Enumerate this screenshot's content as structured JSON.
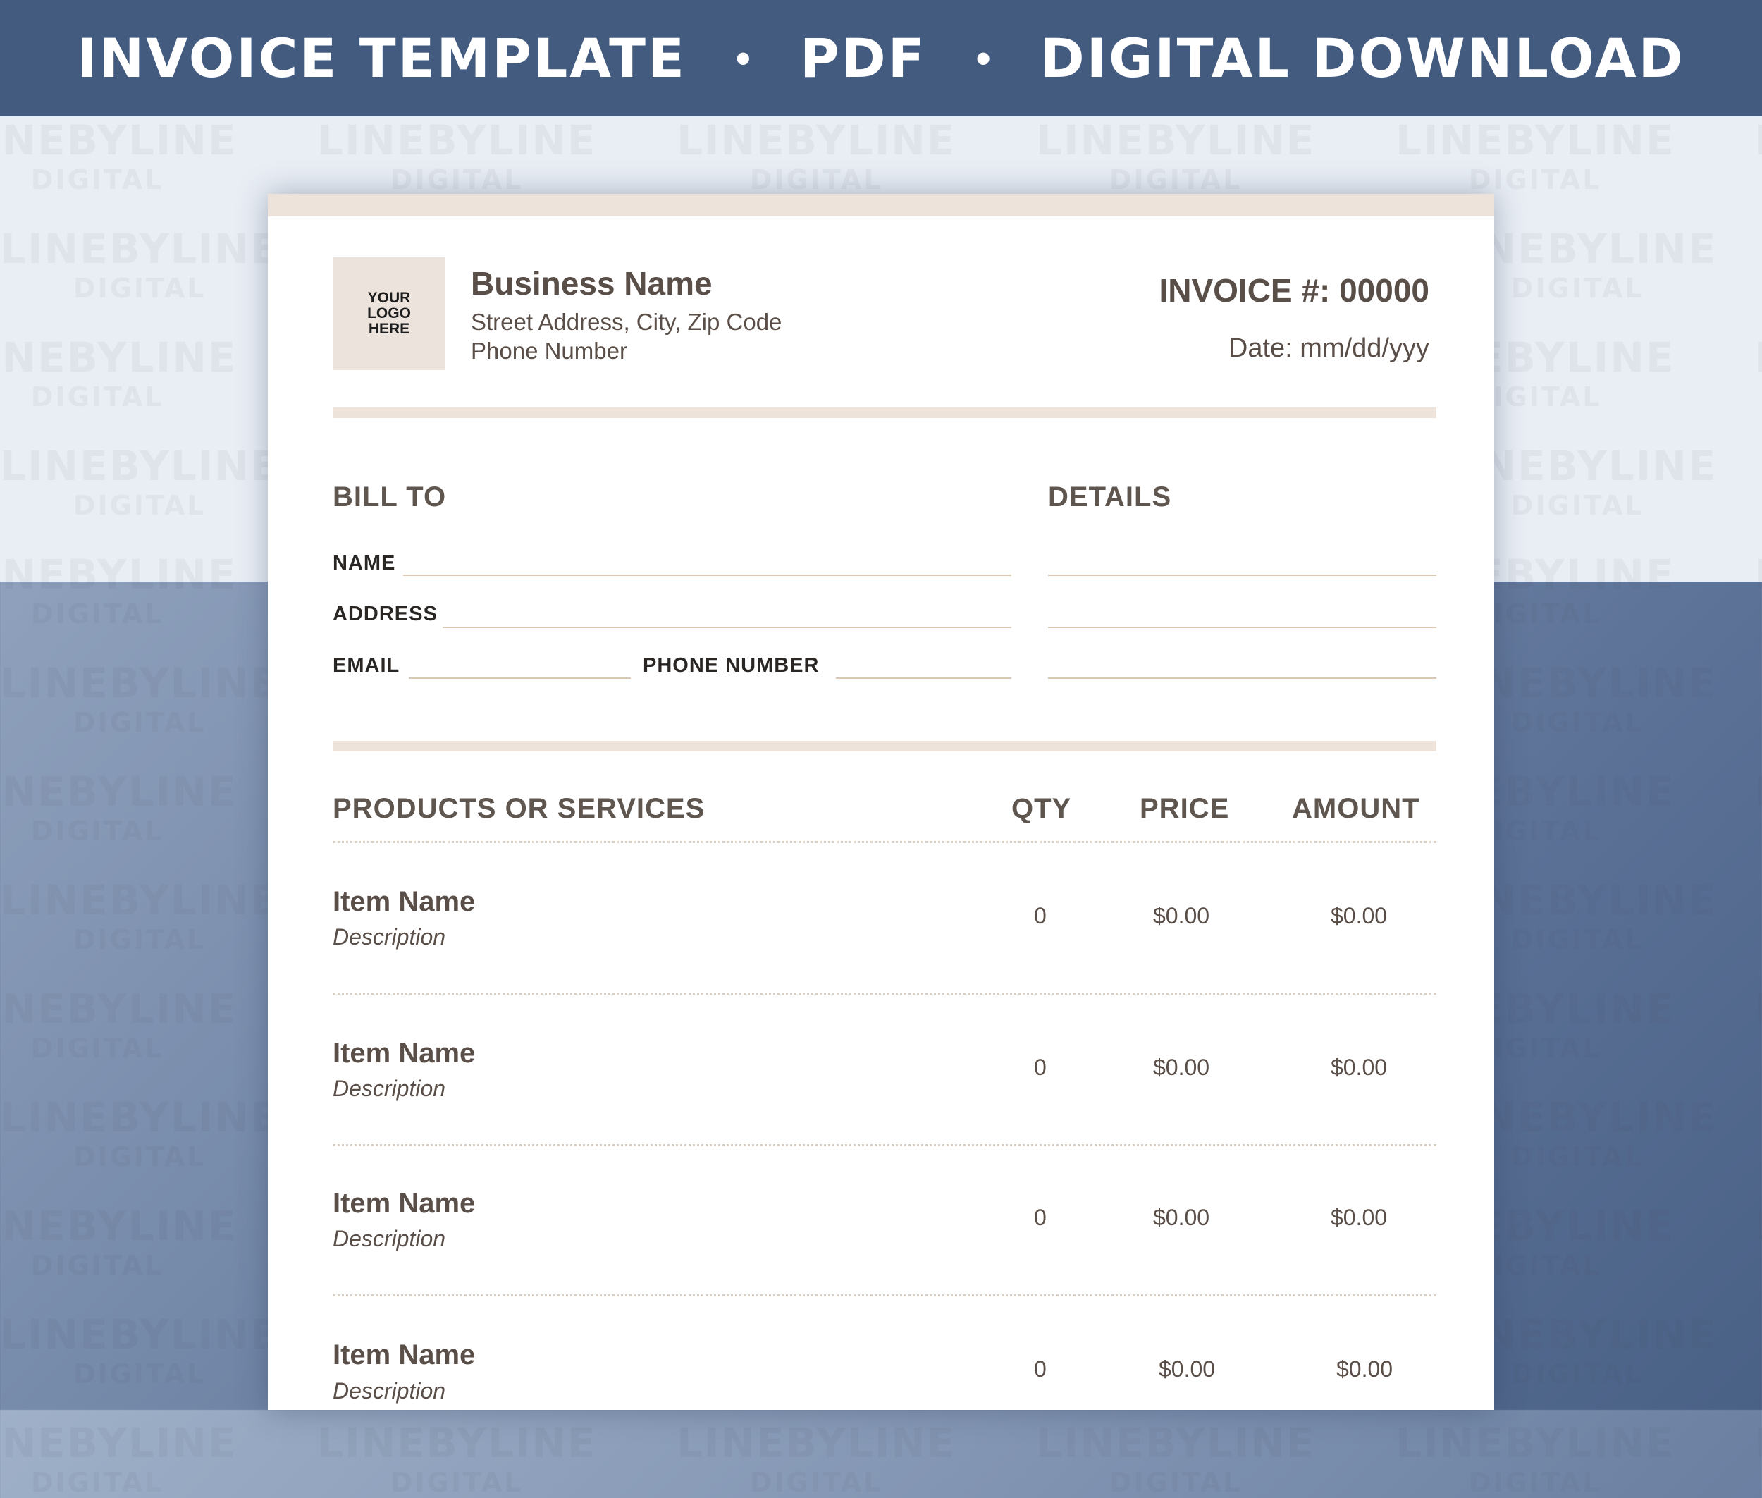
{
  "banner": {
    "part1": "INVOICE TEMPLATE",
    "part2": "PDF",
    "part3": "DIGITAL DOWNLOAD",
    "separator": "•"
  },
  "watermark": {
    "line1": "LINEBYLINE",
    "line2": "DIGITAL"
  },
  "header": {
    "logo_text": "YOUR\nLOGO\nHERE",
    "business_name": "Business Name",
    "address": "Street Address, City, Zip Code",
    "phone": "Phone Number",
    "invoice_number": "INVOICE #: 00000",
    "date": "Date: mm/dd/yyy"
  },
  "bill_to": {
    "title": "BILL TO",
    "name_label": "NAME",
    "address_label": "ADDRESS",
    "email_label": "EMAIL",
    "phone_label": "PHONE NUMBER"
  },
  "details": {
    "title": "DETAILS"
  },
  "table": {
    "headers": {
      "products": "PRODUCTS OR SERVICES",
      "qty": "QTY",
      "price": "PRICE",
      "amount": "AMOUNT"
    },
    "rows": [
      {
        "name": "Item Name",
        "description": "Description",
        "qty": "0",
        "price": "$0.00",
        "amount": "$0.00"
      },
      {
        "name": "Item Name",
        "description": "Description",
        "qty": "0",
        "price": "$0.00",
        "amount": "$0.00"
      },
      {
        "name": "Item Name",
        "description": "Description",
        "qty": "0",
        "price": "$0.00",
        "amount": "$0.00"
      },
      {
        "name": "Item Name",
        "description": "Description",
        "qty": "0",
        "price": "$0.00",
        "amount": "$0.00"
      }
    ]
  },
  "colors": {
    "banner_bg": "#435b7f",
    "accent_beige": "#ede3da",
    "text_brown": "#5a4e48",
    "line_tan": "#d8c8b4"
  }
}
